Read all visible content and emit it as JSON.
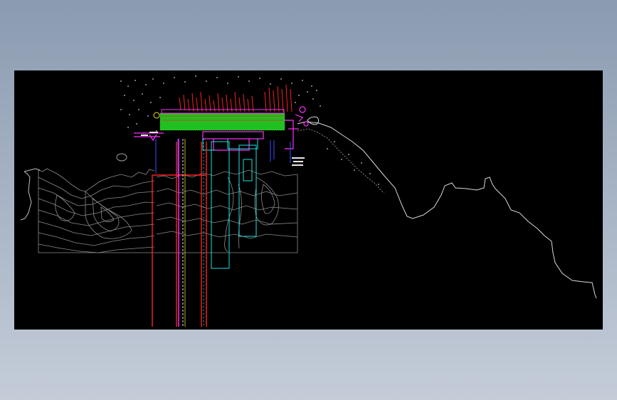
{
  "drawing": {
    "background_color": "#000000",
    "backdrop_colors": [
      "#8b9bb0",
      "#c4ccd8"
    ],
    "layer_colors": {
      "terrain": "#8c8c8c",
      "coastline": "#d8d8d8",
      "road_red": "#ff2020",
      "fill_green": "#20e020",
      "magenta": "#ff30ff",
      "cyan": "#20e0e0",
      "blue": "#3050ff",
      "white": "#e8e8e8",
      "yellow": "#e8e020"
    },
    "icon": "cad-drawing-icon"
  }
}
